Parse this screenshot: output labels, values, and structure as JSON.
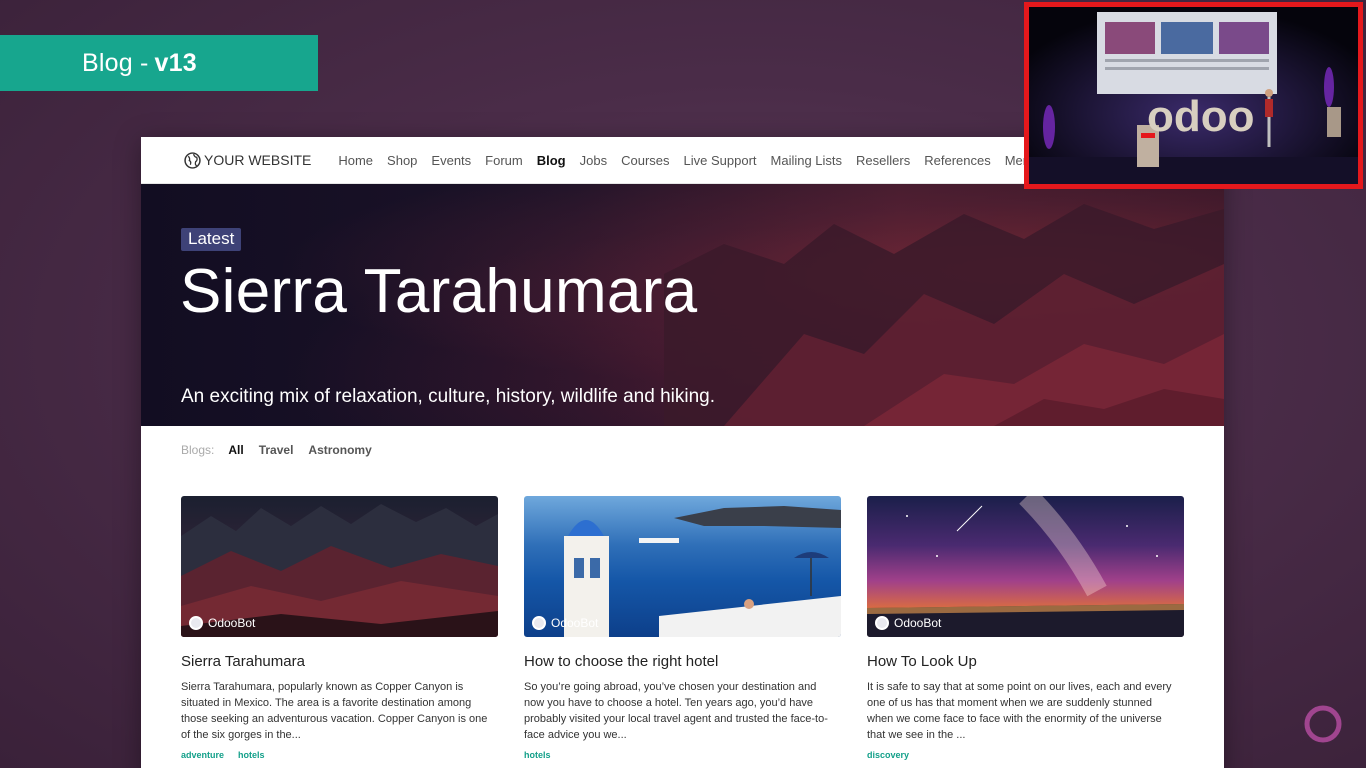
{
  "slide": {
    "title": "Blog - ",
    "version": "v13"
  },
  "website": {
    "brand": "YOUR WEBSITE",
    "nav": [
      "Home",
      "Shop",
      "Events",
      "Forum",
      "Blog",
      "Jobs",
      "Courses",
      "Live Support",
      "Mailing Lists",
      "Resellers",
      "References",
      "Membe"
    ],
    "active_nav": "Blog",
    "hero": {
      "badge": "Latest",
      "title": "Sierra Tarahumara",
      "subtitle": "An exciting mix of relaxation, culture, history, wildlife and hiking."
    },
    "filters": {
      "label": "Blogs:",
      "items": [
        "All",
        "Travel",
        "Astronomy"
      ],
      "active": "All"
    },
    "posts": [
      {
        "author": "OdooBot",
        "title": "Sierra Tarahumara",
        "excerpt": "Sierra Tarahumara, popularly known as Copper Canyon is situated in Mexico. The area is a favorite destination among those seeking an adventurous vacation. Copper Canyon is one of the six gorges in the...",
        "tags": [
          "adventure",
          "hotels"
        ]
      },
      {
        "author": "OdooBot",
        "title": "How to choose the right hotel",
        "excerpt": "So you’re going abroad, you’ve chosen your destination and now you have to choose a hotel. Ten years ago, you’d have probably visited your local travel agent and trusted the face-to-face advice you we...",
        "tags": [
          "hotels"
        ]
      },
      {
        "author": "OdooBot",
        "title": "How To Look Up",
        "excerpt": "It is safe to say that at some point on our lives, each and every one of us has that moment when we are suddenly stunned when we come face to face with the enormity of the universe that we see in the ...",
        "tags": [
          "discovery"
        ]
      }
    ]
  },
  "pip": {
    "stage_logo": "odoo"
  },
  "colors": {
    "banner": "#17a68e",
    "tag": "#14a08a",
    "badge": "#3e4277",
    "pip_border": "#e5181c",
    "corner_logo": "#a0458f"
  }
}
